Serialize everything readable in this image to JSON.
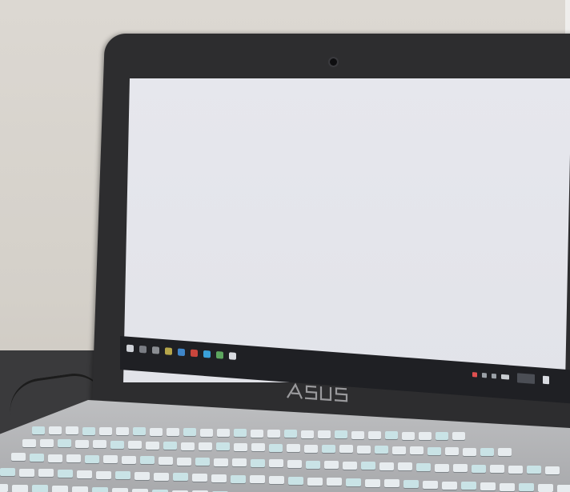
{
  "scene": {
    "description_label": "",
    "brand_logo": "ASUS",
    "colors": {
      "wall": "#d9d5cf",
      "bezel": "#2d2d2f",
      "screen": "#e4e5eb",
      "spinner": "#2b2b2b",
      "taskbar": "#1f2024",
      "keyboard_base": "#b8b9bb",
      "keys": "#e7ecef"
    },
    "icons": [
      "webcam-icon",
      "loading-spinner-icon",
      "taskbar-app-icon",
      "asus-logo-icon",
      "keyboard-key"
    ]
  }
}
